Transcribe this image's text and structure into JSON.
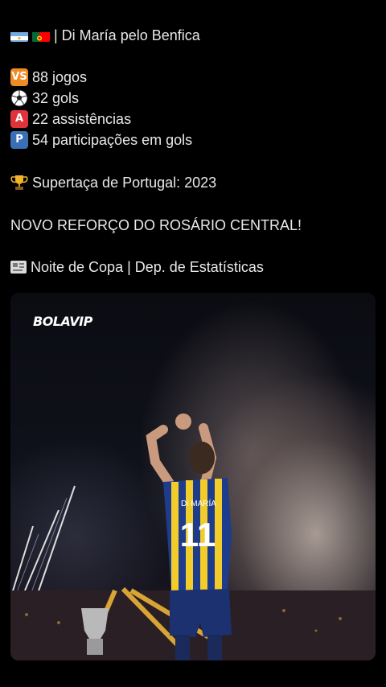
{
  "post": {
    "title": "| Di María pelo Benfica",
    "stats": [
      {
        "icon": "vs-button-icon",
        "badge": "VS",
        "color": "#f08a24",
        "text": "88 jogos"
      },
      {
        "icon": "soccer-ball-icon",
        "text": "32 gols"
      },
      {
        "icon": "a-button-icon",
        "badge": "A",
        "color": "#e0333a",
        "text": "22 assistências"
      },
      {
        "icon": "p-button-icon",
        "badge": "P",
        "color": "#3b6fb5",
        "text": "54 participações em gols"
      }
    ],
    "trophy": "Supertaça de Portugal: 2023",
    "headline": "NOVO REFORÇO DO ROSÁRIO CENTRAL!",
    "source": "Noite de Copa | Dep. de Estatísticas"
  },
  "image": {
    "logo": "BOLAVIP",
    "jersey_name": "Di MARÍA",
    "jersey_number": "11"
  }
}
